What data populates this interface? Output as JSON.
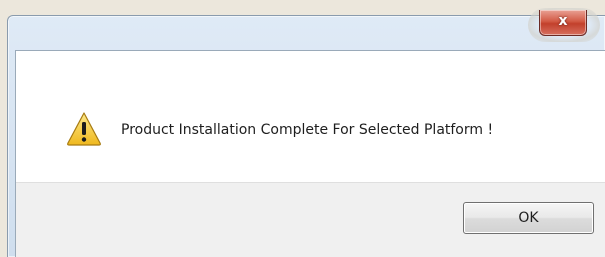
{
  "dialog": {
    "close_glyph": "x",
    "message": "Product Installation Complete For Selected Platform !",
    "icon": "warning-icon",
    "ok_label": "OK"
  },
  "colors": {
    "close_button": "#c2402c",
    "warning_yellow": "#f7d13a",
    "button_area": "#f0f0f0",
    "frame": "#cfdeee"
  }
}
